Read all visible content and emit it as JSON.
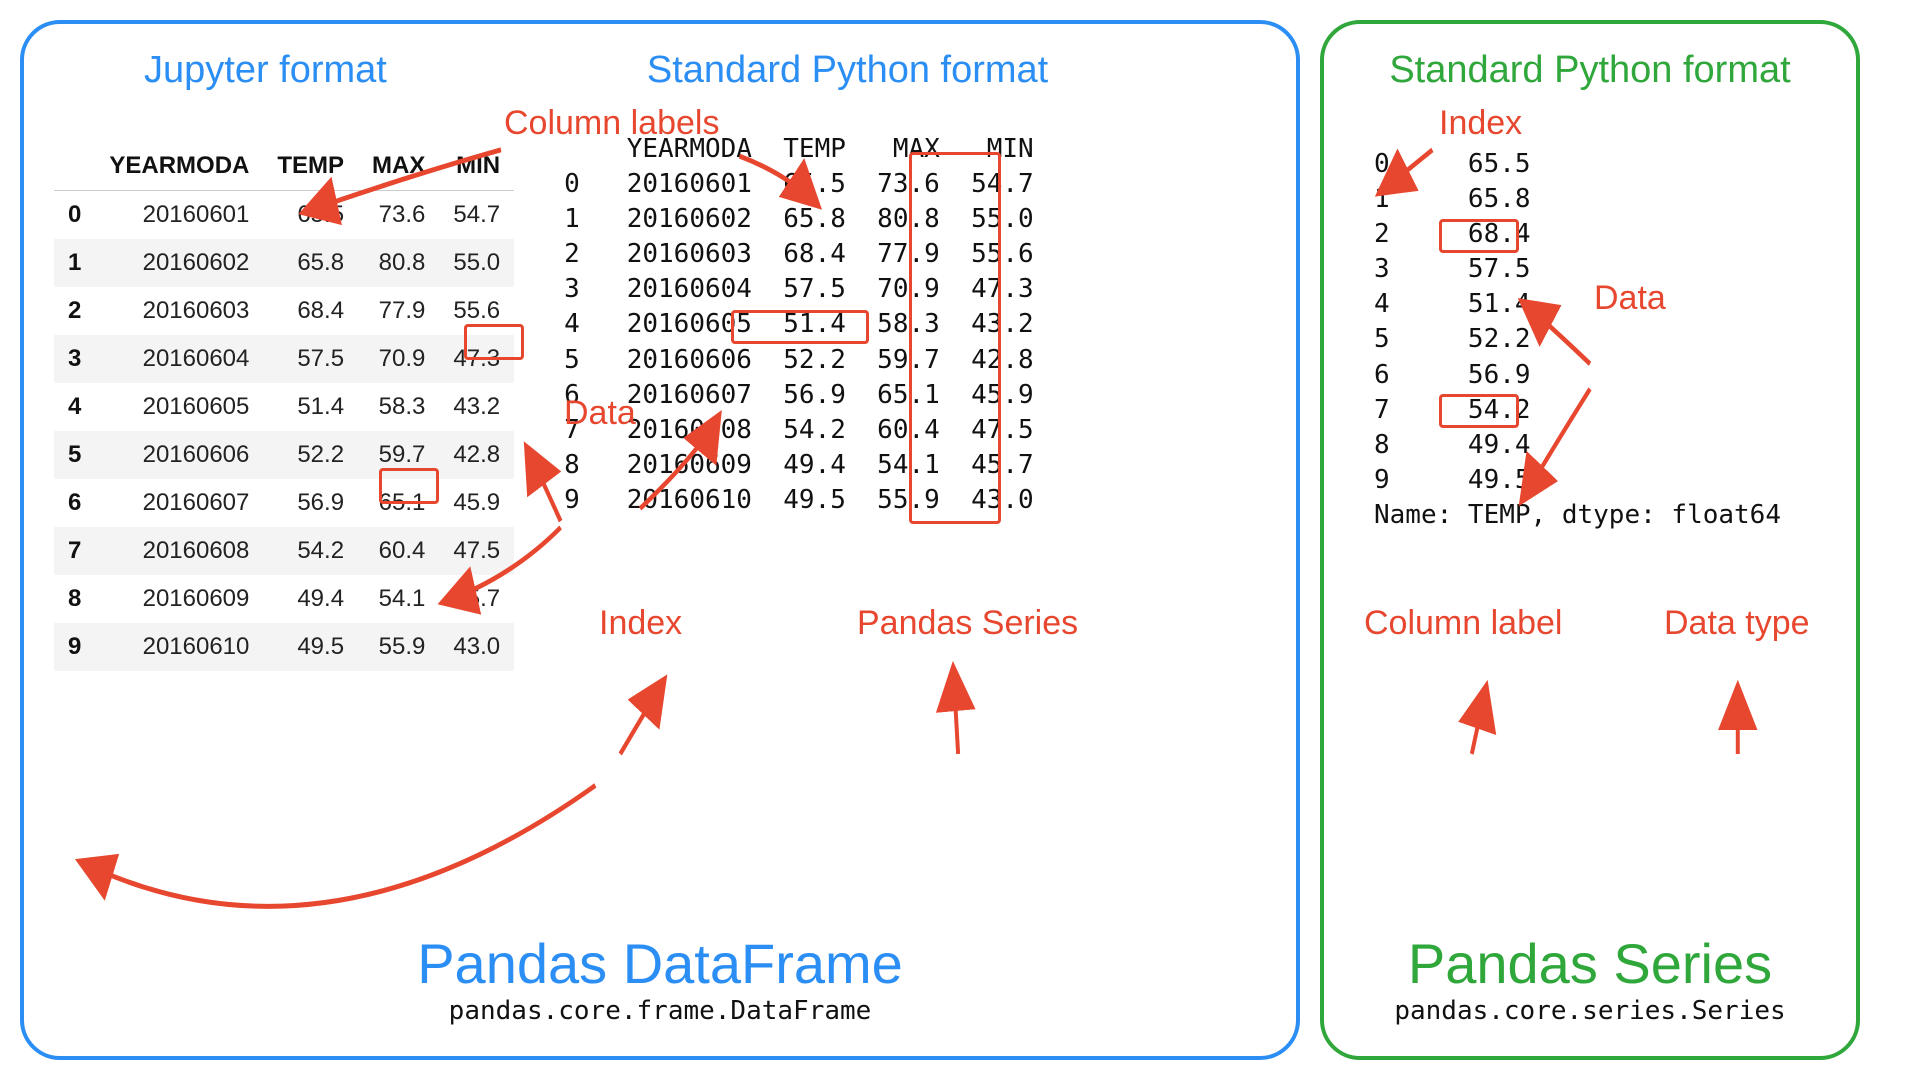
{
  "df_panel": {
    "jupyter_title": "Jupyter format",
    "stdpy_title": "Standard Python format",
    "big_label": "Pandas DataFrame",
    "subtype": "pandas.core.frame.DataFrame",
    "ann": {
      "column_labels": "Column labels",
      "data": "Data",
      "index": "Index",
      "pandas_series": "Pandas Series"
    },
    "columns": [
      "YEARMODA",
      "TEMP",
      "MAX",
      "MIN"
    ],
    "rows": [
      {
        "i": "0",
        "YEARMODA": "20160601",
        "TEMP": "65.5",
        "MAX": "73.6",
        "MIN": "54.7"
      },
      {
        "i": "1",
        "YEARMODA": "20160602",
        "TEMP": "65.8",
        "MAX": "80.8",
        "MIN": "55.0"
      },
      {
        "i": "2",
        "YEARMODA": "20160603",
        "TEMP": "68.4",
        "MAX": "77.9",
        "MIN": "55.6"
      },
      {
        "i": "3",
        "YEARMODA": "20160604",
        "TEMP": "57.5",
        "MAX": "70.9",
        "MIN": "47.3"
      },
      {
        "i": "4",
        "YEARMODA": "20160605",
        "TEMP": "51.4",
        "MAX": "58.3",
        "MIN": "43.2"
      },
      {
        "i": "5",
        "YEARMODA": "20160606",
        "TEMP": "52.2",
        "MAX": "59.7",
        "MIN": "42.8"
      },
      {
        "i": "6",
        "YEARMODA": "20160607",
        "TEMP": "56.9",
        "MAX": "65.1",
        "MIN": "45.9"
      },
      {
        "i": "7",
        "YEARMODA": "20160608",
        "TEMP": "54.2",
        "MAX": "60.4",
        "MIN": "47.5"
      },
      {
        "i": "8",
        "YEARMODA": "20160609",
        "TEMP": "49.4",
        "MAX": "54.1",
        "MIN": "45.7"
      },
      {
        "i": "9",
        "YEARMODA": "20160610",
        "TEMP": "49.5",
        "MAX": "55.9",
        "MIN": "43.0"
      }
    ]
  },
  "series_panel": {
    "stdpy_title": "Standard Python format",
    "big_label": "Pandas Series",
    "subtype": "pandas.core.series.Series",
    "ann": {
      "index": "Index",
      "data": "Data",
      "column_label": "Column label",
      "data_type": "Data type"
    },
    "values": [
      {
        "i": "0",
        "v": "65.5"
      },
      {
        "i": "1",
        "v": "65.8"
      },
      {
        "i": "2",
        "v": "68.4"
      },
      {
        "i": "3",
        "v": "57.5"
      },
      {
        "i": "4",
        "v": "51.4"
      },
      {
        "i": "5",
        "v": "52.2"
      },
      {
        "i": "6",
        "v": "56.9"
      },
      {
        "i": "7",
        "v": "54.2"
      },
      {
        "i": "8",
        "v": "49.4"
      },
      {
        "i": "9",
        "v": "49.5"
      }
    ],
    "footer_line": "Name: TEMP, dtype: float64"
  }
}
